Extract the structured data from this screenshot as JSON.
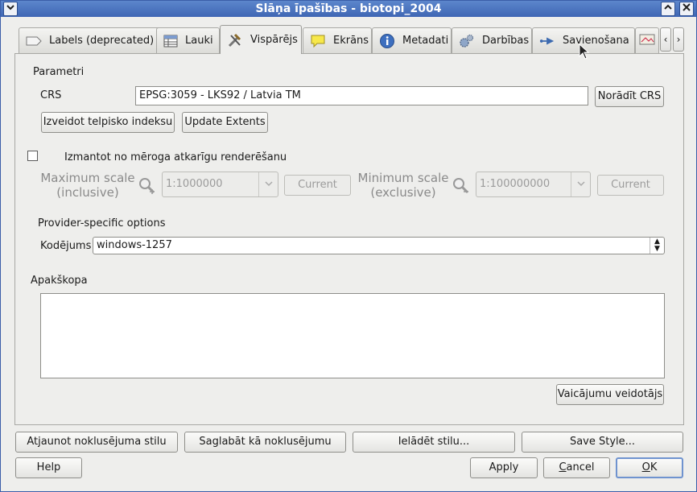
{
  "window": {
    "title": "Slāņa īpašības - biotopi_2004",
    "menu_icon": "chevron-down-icon",
    "minimize_icon": "chevron-up-icon",
    "close_icon": "close-icon"
  },
  "tabs": [
    {
      "label": "Labels (deprecated)",
      "icon": "label-tag-icon"
    },
    {
      "label": "Lauki",
      "icon": "table-icon"
    },
    {
      "label": "Vispārējs",
      "icon": "tools-icon",
      "active": true
    },
    {
      "label": "Ekrāns",
      "icon": "speech-bubble-icon"
    },
    {
      "label": "Metadati",
      "icon": "info-icon"
    },
    {
      "label": "Darbības",
      "icon": "gears-icon"
    },
    {
      "label": "Savienošana",
      "icon": "join-icon"
    }
  ],
  "general": {
    "parameters_title": "Parametri",
    "crs_label": "CRS",
    "crs_value": "EPSG:3059 - LKS92 / Latvia TM",
    "set_crs_button": "Norādīt CRS",
    "create_index_button": "Izveidot telpisko indeksu",
    "update_extents_button": "Update Extents",
    "scale_dependent_label": "Izmantot no mēroga atkarīgu renderēšanu",
    "scale_dependent_checked": false,
    "max_scale_label_1": "Maximum scale",
    "max_scale_label_2": "(inclusive)",
    "max_scale_value": "1:1000000",
    "max_current_button": "Current",
    "min_scale_label_1": "Minimum scale",
    "min_scale_label_2": "(exclusive)",
    "min_scale_value": "1:100000000",
    "min_current_button": "Current",
    "provider_title": "Provider-specific options",
    "encoding_label": "Kodējums",
    "encoding_value": "windows-1257",
    "subset_title": "Apakškopa",
    "subset_value": "",
    "query_builder_button": "Vaicājumu veidotājs"
  },
  "style_buttons": {
    "restore_default": "Atjaunot noklusējuma stilu",
    "save_default": "Saglabāt kā noklusējumu",
    "load_style": "Ielādēt stilu...",
    "save_style": "Save Style..."
  },
  "bottom_buttons": {
    "help": "Help",
    "apply": "Apply",
    "cancel_prefix": "",
    "cancel_mnemonic": "C",
    "cancel_rest": "ancel",
    "ok_mnemonic": "O",
    "ok_rest": "K"
  }
}
